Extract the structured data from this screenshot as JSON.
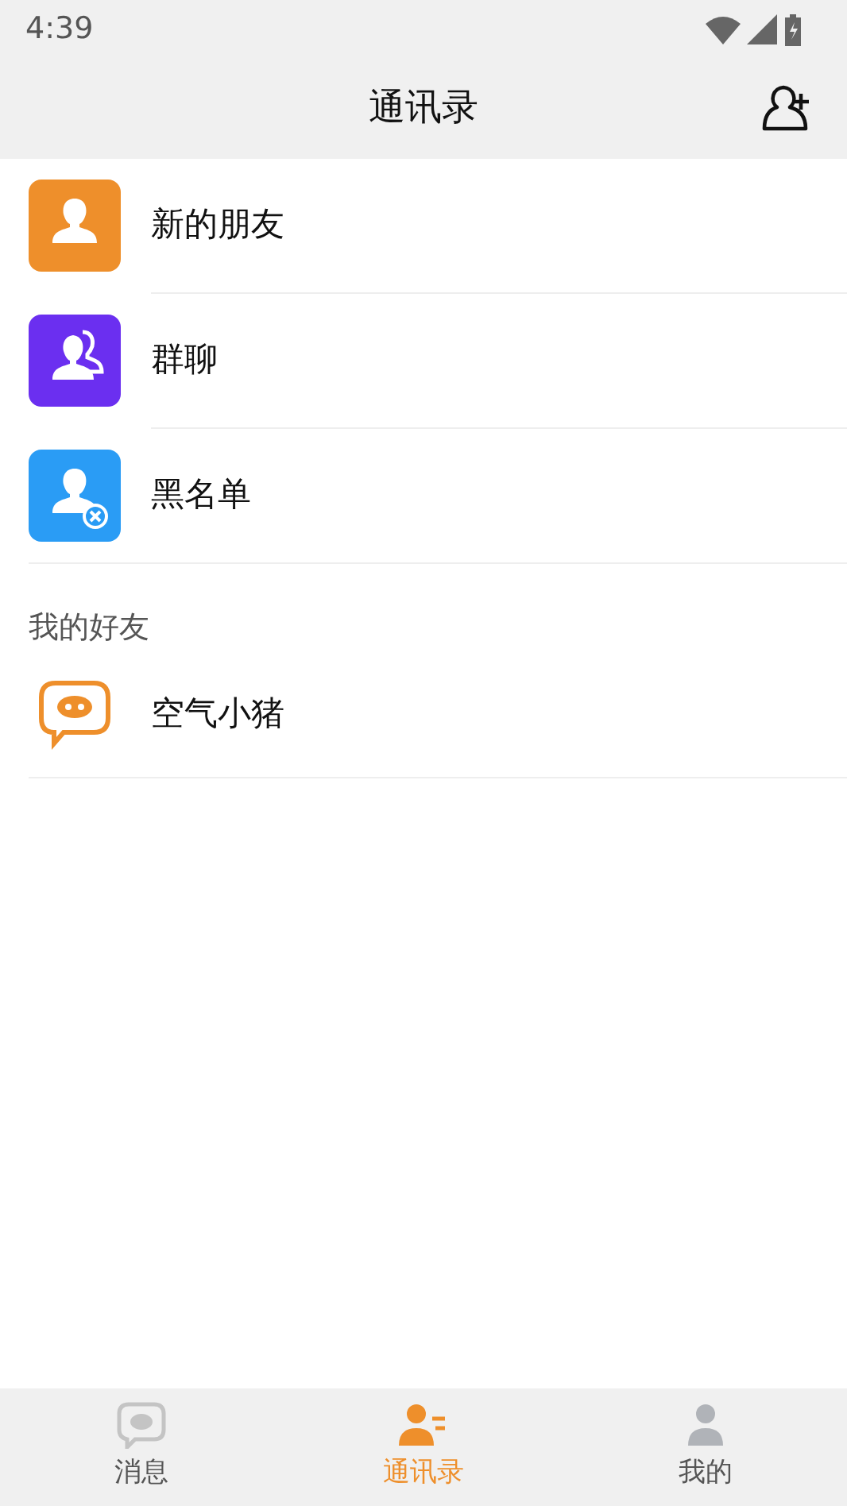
{
  "status_bar": {
    "time": "4:39"
  },
  "header": {
    "title": "通讯录"
  },
  "entries": [
    {
      "label": "新的朋友",
      "kind": "new-friends",
      "color": "#ee8f2b"
    },
    {
      "label": "群聊",
      "kind": "group",
      "color": "#6b2ff0"
    },
    {
      "label": "黑名单",
      "kind": "blocked",
      "color": "#2a9cf5"
    }
  ],
  "friends_section": {
    "title": "我的好友",
    "friends": [
      {
        "name": "空气小猪"
      }
    ]
  },
  "tabs": [
    {
      "label": "消息",
      "kind": "chat",
      "selected": false
    },
    {
      "label": "通讯录",
      "kind": "contacts",
      "selected": true
    },
    {
      "label": "我的",
      "kind": "me",
      "selected": false
    }
  ]
}
